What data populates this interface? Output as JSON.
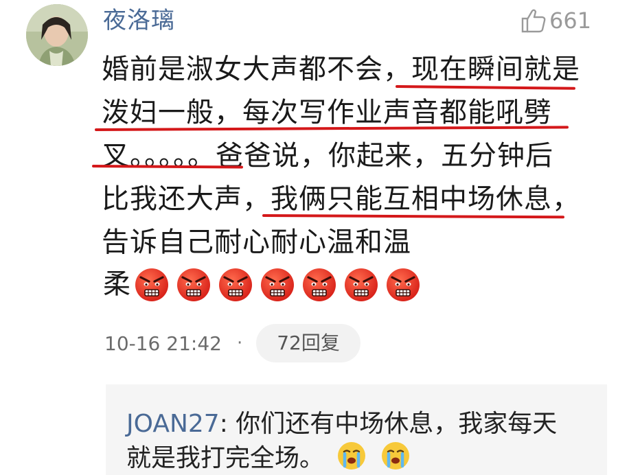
{
  "comment": {
    "username": "夜洛璃",
    "like_count": "661",
    "lines": [
      "婚前是淑女大声都不会，现在瞬间就是",
      "泼妇一般，每次写作业声音都能吼劈",
      "叉。。。。。爸爸说，你起来，五分钟后",
      "比我还大声，我俩只能互相中场休息，",
      "告诉自己耐心耐心温和温"
    ],
    "last_line_text": "柔",
    "emoji_name": "angry-face-icon",
    "emoji_count": 7,
    "timestamp": "10-16 21:42",
    "separator": "·",
    "reply_button": "72回复"
  },
  "reply": {
    "author": "JOAN27",
    "text_line1": ": 你们还有中场休息，我家每天",
    "text_line2": "就是我打完全场。",
    "emoji_name": "crying-face-icon",
    "emoji_count": 2
  },
  "colors": {
    "username": "#4a6a96",
    "underline": "#d4181a",
    "text": "#1a1a1a",
    "meta": "#6b6b6b",
    "reply_bg": "#f5f5f5"
  }
}
